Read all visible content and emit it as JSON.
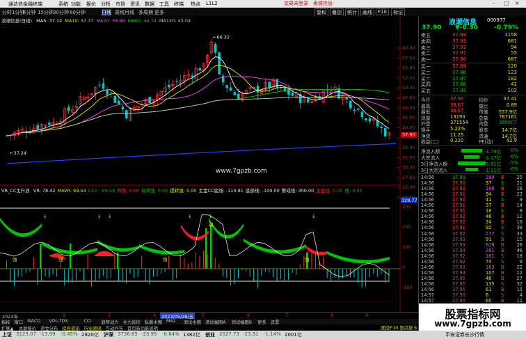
{
  "titlebar": {
    "app": "通达信金融终端",
    "menus": [
      "系统",
      "功能",
      "报价",
      "分析",
      "市场",
      "资讯",
      "数据",
      "工具",
      "终端",
      "热点",
      "L1L2"
    ],
    "alert": "交易未登录",
    "trade": "表情信息",
    "icons": [
      "minimize-icon",
      "restore-icon",
      "close-icon"
    ]
  },
  "toolbar": {
    "periods": [
      "分时",
      "1分钟",
      "5分钟",
      "15分钟",
      "30分钟",
      "60分钟",
      "日线",
      "周线",
      "月线",
      "多周期",
      "更多"
    ],
    "buttons": [
      "复权",
      "叠加",
      "统计",
      "画线",
      "F10",
      "标记"
    ],
    "selected": "日线"
  },
  "main_header": {
    "stock": "浪潮信息(日线)",
    "items": [
      {
        "t": "MA5: 37.12",
        "c": "#ffffff"
      },
      {
        "t": "MA10: 37.77",
        "c": "#e8e800"
      },
      {
        "t": "MA20: 38.99",
        "c": "#ff40ff"
      },
      {
        "t": "MA60: 44.74",
        "c": "#00d000"
      },
      {
        "t": "MA120: 43.04",
        "c": "#c0c0c0"
      }
    ]
  },
  "price_axis": [
    "60.00",
    "57.50",
    "55.00",
    "52.50",
    "50.00",
    "47.50",
    "45.00",
    "42.50",
    "40.00",
    "37.50",
    "35.00",
    "32.50",
    "30.00",
    "27.50",
    "25.00",
    "22.50"
  ],
  "annotations": {
    "high": "66.32",
    "low": "37.24",
    "watermark": "www.7gpzb.com",
    "current_price": "37.90"
  },
  "ind_header": {
    "name": "VR_CC主升浪",
    "items": [
      {
        "t": "VR: 78.42",
        "c": "#e8e8e8"
      },
      {
        "t": "MAVR: 69.54",
        "c": "#e8e800"
      },
      {
        "t": "CC1: -69.56",
        "c": "#00c000"
      },
      {
        "t": "转强: 0.00",
        "c": "#ff3030"
      },
      {
        "t": "弱转强: 0.00",
        "c": "#00c000"
      },
      {
        "t": "提转强: 0.00",
        "c": "#e8e800"
      },
      {
        "t": "主金CC底线: -110.81",
        "c": "#e8e8e8"
      },
      {
        "t": "底部线: -100.00",
        "c": "#e8e8e8"
      },
      {
        "t": "警戒线: 300.00",
        "c": "#e8e8e8"
      },
      {
        "t": "主金线: 0.00",
        "c": "#ff3030"
      },
      {
        "t": "线: 0.00",
        "c": "#00c000"
      }
    ]
  },
  "ind_axis": [
    "300",
    "200",
    "100",
    "0",
    "-100"
  ],
  "ind_value": "329.77",
  "ind_labels": {
    "up": "强",
    "dn": "弱"
  },
  "date_axis": {
    "left": "2023年",
    "mid": "2023/05/26/五",
    "ticks": [
      "2",
      "3",
      "4",
      "5",
      "6",
      "7",
      "8",
      "9"
    ]
  },
  "bottom_tabs": [
    "指标",
    "窗口",
    "MACD",
    "VOL-TDX",
    "CCI",
    "趋势动力",
    "主力监控",
    "私募主图",
    "MA2",
    "测试主图",
    "测试幅图A",
    "测试幅图B",
    "更多",
    "设置"
  ],
  "bottom_tabs2": [
    "扩展▲",
    "关联报价",
    "资金分布",
    "综合资讯",
    "行业资讯",
    "互动问答",
    "首页新功能说明"
  ],
  "panel": {
    "name": "浪潮信息",
    "code": "000977",
    "price": "37.90",
    "change": "-0.30",
    "pct": "-0.79%",
    "sells": [
      {
        "l": "卖五",
        "p": "37.94",
        "v": "1158"
      },
      {
        "l": "卖四",
        "p": "37.93",
        "v": "681"
      },
      {
        "l": "卖三",
        "p": "37.92",
        "v": "94"
      },
      {
        "l": "卖二",
        "p": "37.91",
        "v": "55"
      },
      {
        "l": "卖一",
        "p": "37.90",
        "v": "687"
      }
    ],
    "buys": [
      {
        "l": "买一",
        "p": "37.89",
        "v": "120"
      },
      {
        "l": "买二",
        "p": "37.88",
        "v": "123"
      },
      {
        "l": "买三",
        "p": "37.87",
        "v": "182"
      },
      {
        "l": "买四",
        "p": "37.86",
        "v": "41"
      },
      {
        "l": "买五",
        "p": "37.85",
        "v": "102"
      }
    ],
    "stats": [
      [
        "今开",
        "37.90",
        "均价",
        "37.41"
      ],
      [
        "最高",
        "38.67",
        "量比",
        "0.89"
      ],
      [
        "最低",
        "36.67",
        "市值",
        "557.9亿"
      ],
      [
        "现量",
        "13193",
        "总量",
        "767161"
      ],
      [
        "外盘",
        "371554",
        "内盘",
        "395607"
      ],
      [
        "换手",
        "5.22%",
        "股本",
        "14.7亿"
      ],
      [
        "净资",
        "11.25",
        "流通",
        "14.7亿"
      ],
      [
        "收益(二)",
        "0.220",
        "PE(动)",
        "42.9"
      ]
    ],
    "flows": [
      {
        "l": "净流入额",
        "v": "-1.79亿",
        "pct": "-8%",
        "w": 30
      },
      {
        "l": "大宗流入",
        "v": "-1.17亿",
        "pct": "-6%",
        "w": 22
      },
      {
        "l": "5日净流入额",
        "v": "-5.81亿",
        "pct": "-5%",
        "w": 40
      },
      {
        "l": "5日大宗流入",
        "v": "-1.11亿",
        "pct": "-6%",
        "w": 18
      }
    ],
    "ticks": [
      [
        "14:56",
        "37.89",
        "289",
        "B",
        "25"
      ],
      [
        "14:56",
        "37.90",
        "37",
        "S",
        "21"
      ],
      [
        "14:56",
        "37.90",
        "188",
        "B",
        "16"
      ],
      [
        "14:56",
        "37.91",
        "94",
        "B",
        "23"
      ],
      [
        "14:56",
        "37.90",
        "41",
        "S",
        "9"
      ],
      [
        "14:56",
        "37.91",
        "37",
        "B",
        "14"
      ],
      [
        "14:56",
        "37.91",
        "18",
        "S",
        "8"
      ],
      [
        "14:56",
        "37.92",
        "46",
        "B",
        "12"
      ],
      [
        "14:56",
        "37.92",
        "24",
        "B",
        "16"
      ],
      [
        "14:56",
        "37.91",
        "92",
        "S",
        "38"
      ],
      [
        "14:56",
        "37.92",
        "277",
        "S",
        "33"
      ],
      [
        "14:56",
        "37.93",
        "91",
        "B",
        "15"
      ],
      [
        "14:56",
        "37.93",
        "628",
        "B",
        "26"
      ],
      [
        "14:56",
        "37.94",
        "261",
        "B",
        "46"
      ],
      [
        "14:56",
        "37.92",
        "161",
        "S",
        "18"
      ],
      [
        "14:56",
        "37.92",
        "74",
        "S",
        "9"
      ],
      [
        "14:56",
        "37.93",
        "163",
        "B",
        "22"
      ],
      [
        "14:56",
        "37.94",
        "107",
        "B",
        "12"
      ],
      [
        "14:56",
        "37.95",
        "46",
        "B",
        "27"
      ],
      [
        "14:56",
        "37.95",
        "135",
        "S",
        "32"
      ],
      [
        "14:56",
        "37.95",
        "61",
        "B",
        "15"
      ],
      [
        "14:57",
        "37.90",
        "6",
        "S",
        "4"
      ],
      [
        "14:57",
        "37.90",
        "60",
        "B",
        "11"
      ]
    ]
  },
  "statusbar": [
    {
      "t": "上证",
      "c": "#000"
    },
    {
      "t": "3123.07",
      "c": "#008000"
    },
    {
      "t": "-13.99",
      "c": "#008000"
    },
    {
      "t": "-0.45%",
      "c": "#008000"
    },
    {
      "t": "2820亿",
      "c": "#000"
    },
    {
      "t": "沪深",
      "c": "#000"
    },
    {
      "t": "3736.65",
      "c": "#008000"
    },
    {
      "t": "-23.95",
      "c": "#008000"
    },
    {
      "t": "-0.64%",
      "c": "#008000"
    },
    {
      "t": "1382亿",
      "c": "#000"
    },
    {
      "t": "创业",
      "c": "#000"
    },
    {
      "t": "2027.73",
      "c": "#008000"
    },
    {
      "t": "-23.31",
      "c": "#008000"
    },
    {
      "t": "-1.14%",
      "c": "#008000"
    },
    {
      "t": "2001亿",
      "c": "#000"
    }
  ],
  "statusbar_right": "平安证券长沙行情",
  "hint": "图交F10 到点按 6",
  "brand": {
    "title": "股票指标网",
    "url": "www.7gpzb.com"
  },
  "colors": {
    "up": "#ff3030",
    "down": "#00c8c8",
    "ma5": "#ffffff",
    "ma10": "#e8e800",
    "ma20": "#ff40ff",
    "ma60": "#00d000",
    "ma120": "#c0c0c0",
    "base": "#2040ff"
  }
}
